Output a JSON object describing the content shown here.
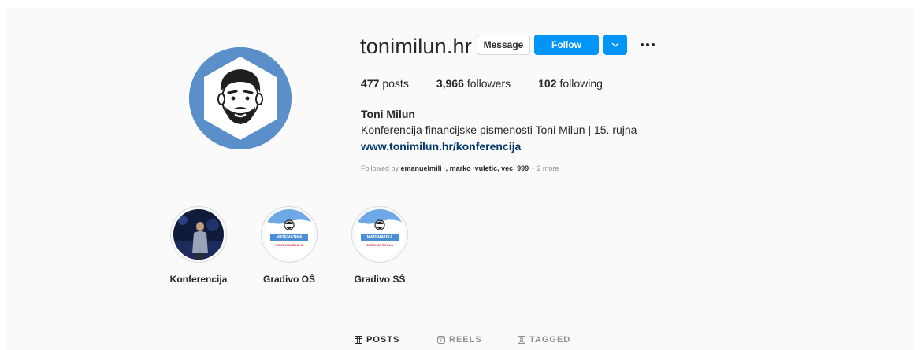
{
  "profile": {
    "username": "tonimilun.hr",
    "full_name": "Toni Milun",
    "bio": "Konferencija financijske pismenosti Toni Milun | 15. rujna",
    "link": "www.tonimilun.hr/konferencija",
    "avatar_icon": "avatar-cartoon-man-icon"
  },
  "actions": {
    "message_label": "Message",
    "follow_label": "Follow",
    "more_follow_icon": "chevron-down-icon",
    "options_icon": "more-options-icon"
  },
  "stats": {
    "posts_count": "477",
    "posts_label": "posts",
    "followers_count": "3,966",
    "followers_label": "followers",
    "following_count": "102",
    "following_label": "following"
  },
  "followed_by": {
    "prefix": "Followed by",
    "names": "emanuelmili_, marko_vuletic, vec_999",
    "more": "+ 2 more"
  },
  "highlights": [
    {
      "label": "Konferencija"
    },
    {
      "label": "Gradivo OŠ",
      "badge_title": "MATEMATIKA",
      "badge_sub": "OSNOVNA ŠKOLA"
    },
    {
      "label": "Gradivo SŠ",
      "badge_title": "MATEMATIKA",
      "badge_sub": "SREDNJA ŠKOLA"
    }
  ],
  "tabs": [
    {
      "label": "POSTS",
      "icon": "grid-icon",
      "active": true
    },
    {
      "label": "REELS",
      "icon": "reels-icon",
      "active": false
    },
    {
      "label": "TAGGED",
      "icon": "tagged-icon",
      "active": false
    }
  ],
  "colors": {
    "accent": "#0095f6",
    "link": "#00376b",
    "avatar_bg": "#5b8fc9"
  }
}
